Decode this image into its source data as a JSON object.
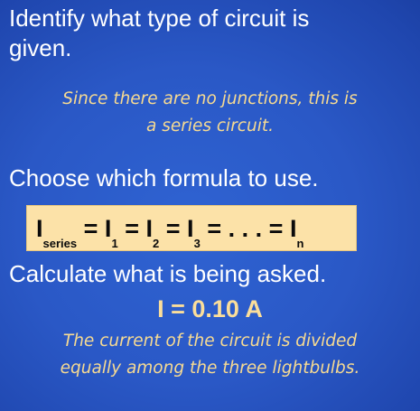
{
  "slide": {
    "step1_heading_line1": "Identify what type of circuit is",
    "step1_heading_line2": "given.",
    "step1_note_line1": "Since there are no junctions, this is",
    "step1_note_line2": "a series circuit.",
    "step2_heading": "Choose which formula to use.",
    "formula": {
      "symbol": "I",
      "sub_series": "series",
      "sub_1": "1",
      "sub_2": "2",
      "sub_3": "3",
      "sub_n": "n",
      "equals": "=",
      "ellipsis": ". . ."
    },
    "step3_heading": "Calculate what is being asked.",
    "answer": "I = 0.10 A",
    "conclusion_line1": "The current of the circuit is divided",
    "conclusion_line2": "equally among the three lightbulbs."
  },
  "colors": {
    "background": "#2a58c6",
    "heading_text": "#ffffff",
    "note_text": "#f6da92",
    "formula_box": "#fce2a8",
    "answer_text": "#fbde9a"
  }
}
